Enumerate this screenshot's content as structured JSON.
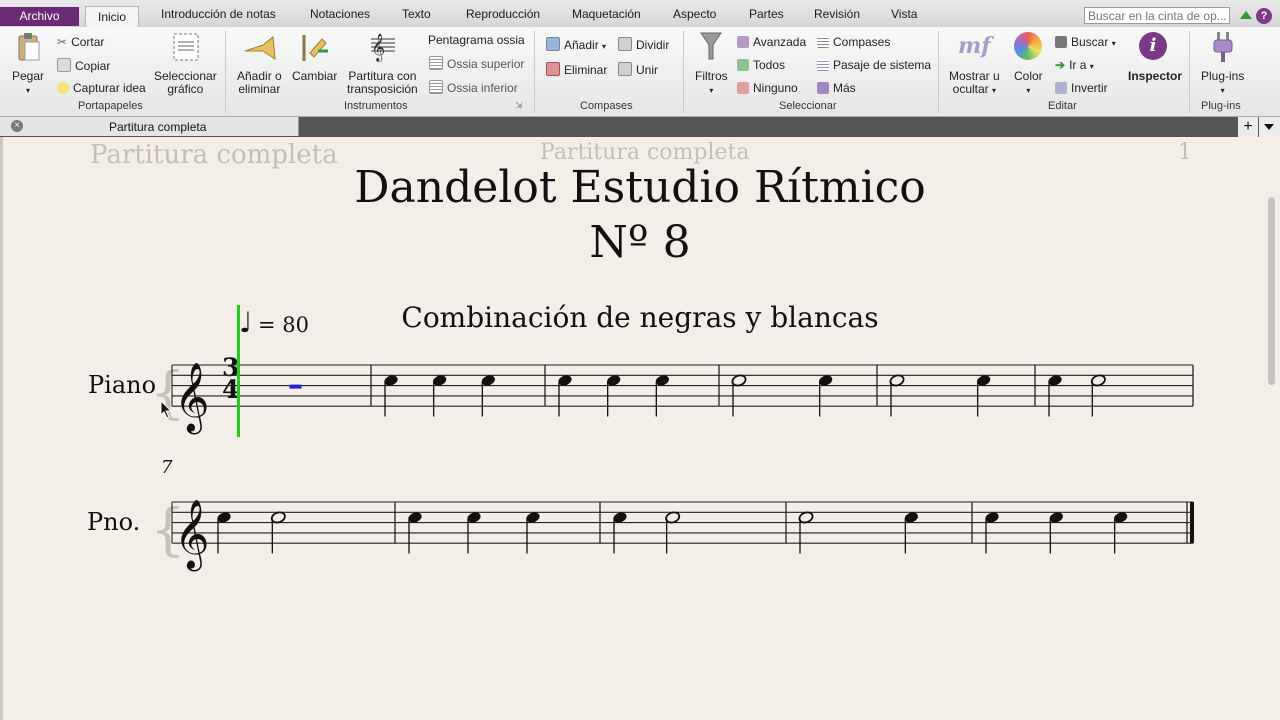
{
  "tabs": {
    "archivo": "Archivo",
    "inicio": "Inicio",
    "introduccion": "Introducción de notas",
    "notaciones": "Notaciones",
    "texto": "Texto",
    "reproduccion": "Reproducción",
    "maquetacion": "Maquetación",
    "aspecto": "Aspecto",
    "partes": "Partes",
    "revision": "Revisión",
    "vista": "Vista"
  },
  "search": {
    "placeholder": "Buscar en la cinta de op..."
  },
  "ribbon": {
    "portapapeles": {
      "label": "Portapapeles",
      "pegar": "Pegar",
      "cortar": "Cortar",
      "copiar": "Copiar",
      "capturar": "Capturar idea",
      "seleccionar_l1": "Seleccionar",
      "seleccionar_l2": "gráfico"
    },
    "instrumentos": {
      "label": "Instrumentos",
      "anadir_l1": "Añadir o",
      "anadir_l2": "eliminar",
      "cambiar": "Cambiar",
      "partitura_l1": "Partitura con",
      "partitura_l2": "transposición",
      "pentagrama": "Pentagrama ossia",
      "ossia_sup": "Ossia superior",
      "ossia_inf": "Ossia inferior"
    },
    "compases": {
      "label": "Compases",
      "anadir": "Añadir",
      "dividir": "Dividir",
      "eliminar": "Eliminar",
      "unir": "Unir"
    },
    "seleccionar": {
      "label": "Seleccionar",
      "filtros": "Filtros",
      "avanzada": "Avanzada",
      "todos": "Todos",
      "ninguno": "Ninguno",
      "compases": "Compases",
      "pasaje": "Pasaje de sistema",
      "mas": "Más"
    },
    "editar": {
      "label": "Editar",
      "mostrar_l1": "Mostrar u",
      "mostrar_l2": "ocultar",
      "color": "Color",
      "buscar": "Buscar",
      "ir_a": "Ir a",
      "invertir": "Invertir",
      "inspector": "Inspector",
      "mf_glyph": "mf"
    },
    "plugins": {
      "label": "Plug-ins",
      "plugins": "Plug-ins"
    }
  },
  "document_tab": {
    "label": "Partitura completa"
  },
  "score": {
    "header_left": "Partitura completa",
    "header_center": "Partitura completa",
    "page_number": "1",
    "title": "Dandelot Estudio Rítmico",
    "subtitle": "Nº 8",
    "tempo_value": "= 80",
    "tempo_note": "♩",
    "subtitle2": "Combinación de negras y blancas",
    "instrument_full": "Piano",
    "instrument_short": "Pno.",
    "time_sig_top": "3",
    "time_sig_bottom": "4",
    "bar_number_system2": "7",
    "clef_glyph": "𝄞"
  },
  "colors": {
    "archivo_bg": "#6b2a76",
    "playback_line": "#22cc22",
    "selection": "#2222dd",
    "paper": "#f3eee8"
  },
  "music": {
    "system1": [
      [
        "rest"
      ],
      [
        "q",
        "q",
        "q"
      ],
      [
        "q",
        "q",
        "q"
      ],
      [
        "h",
        "q"
      ],
      [
        "h",
        "q"
      ],
      [
        "q",
        "h"
      ]
    ],
    "system2": [
      [
        "q",
        "h"
      ],
      [
        "q",
        "q",
        "q"
      ],
      [
        "q",
        "h"
      ],
      [
        "h",
        "q"
      ],
      [
        "q",
        "q",
        "q"
      ]
    ]
  }
}
